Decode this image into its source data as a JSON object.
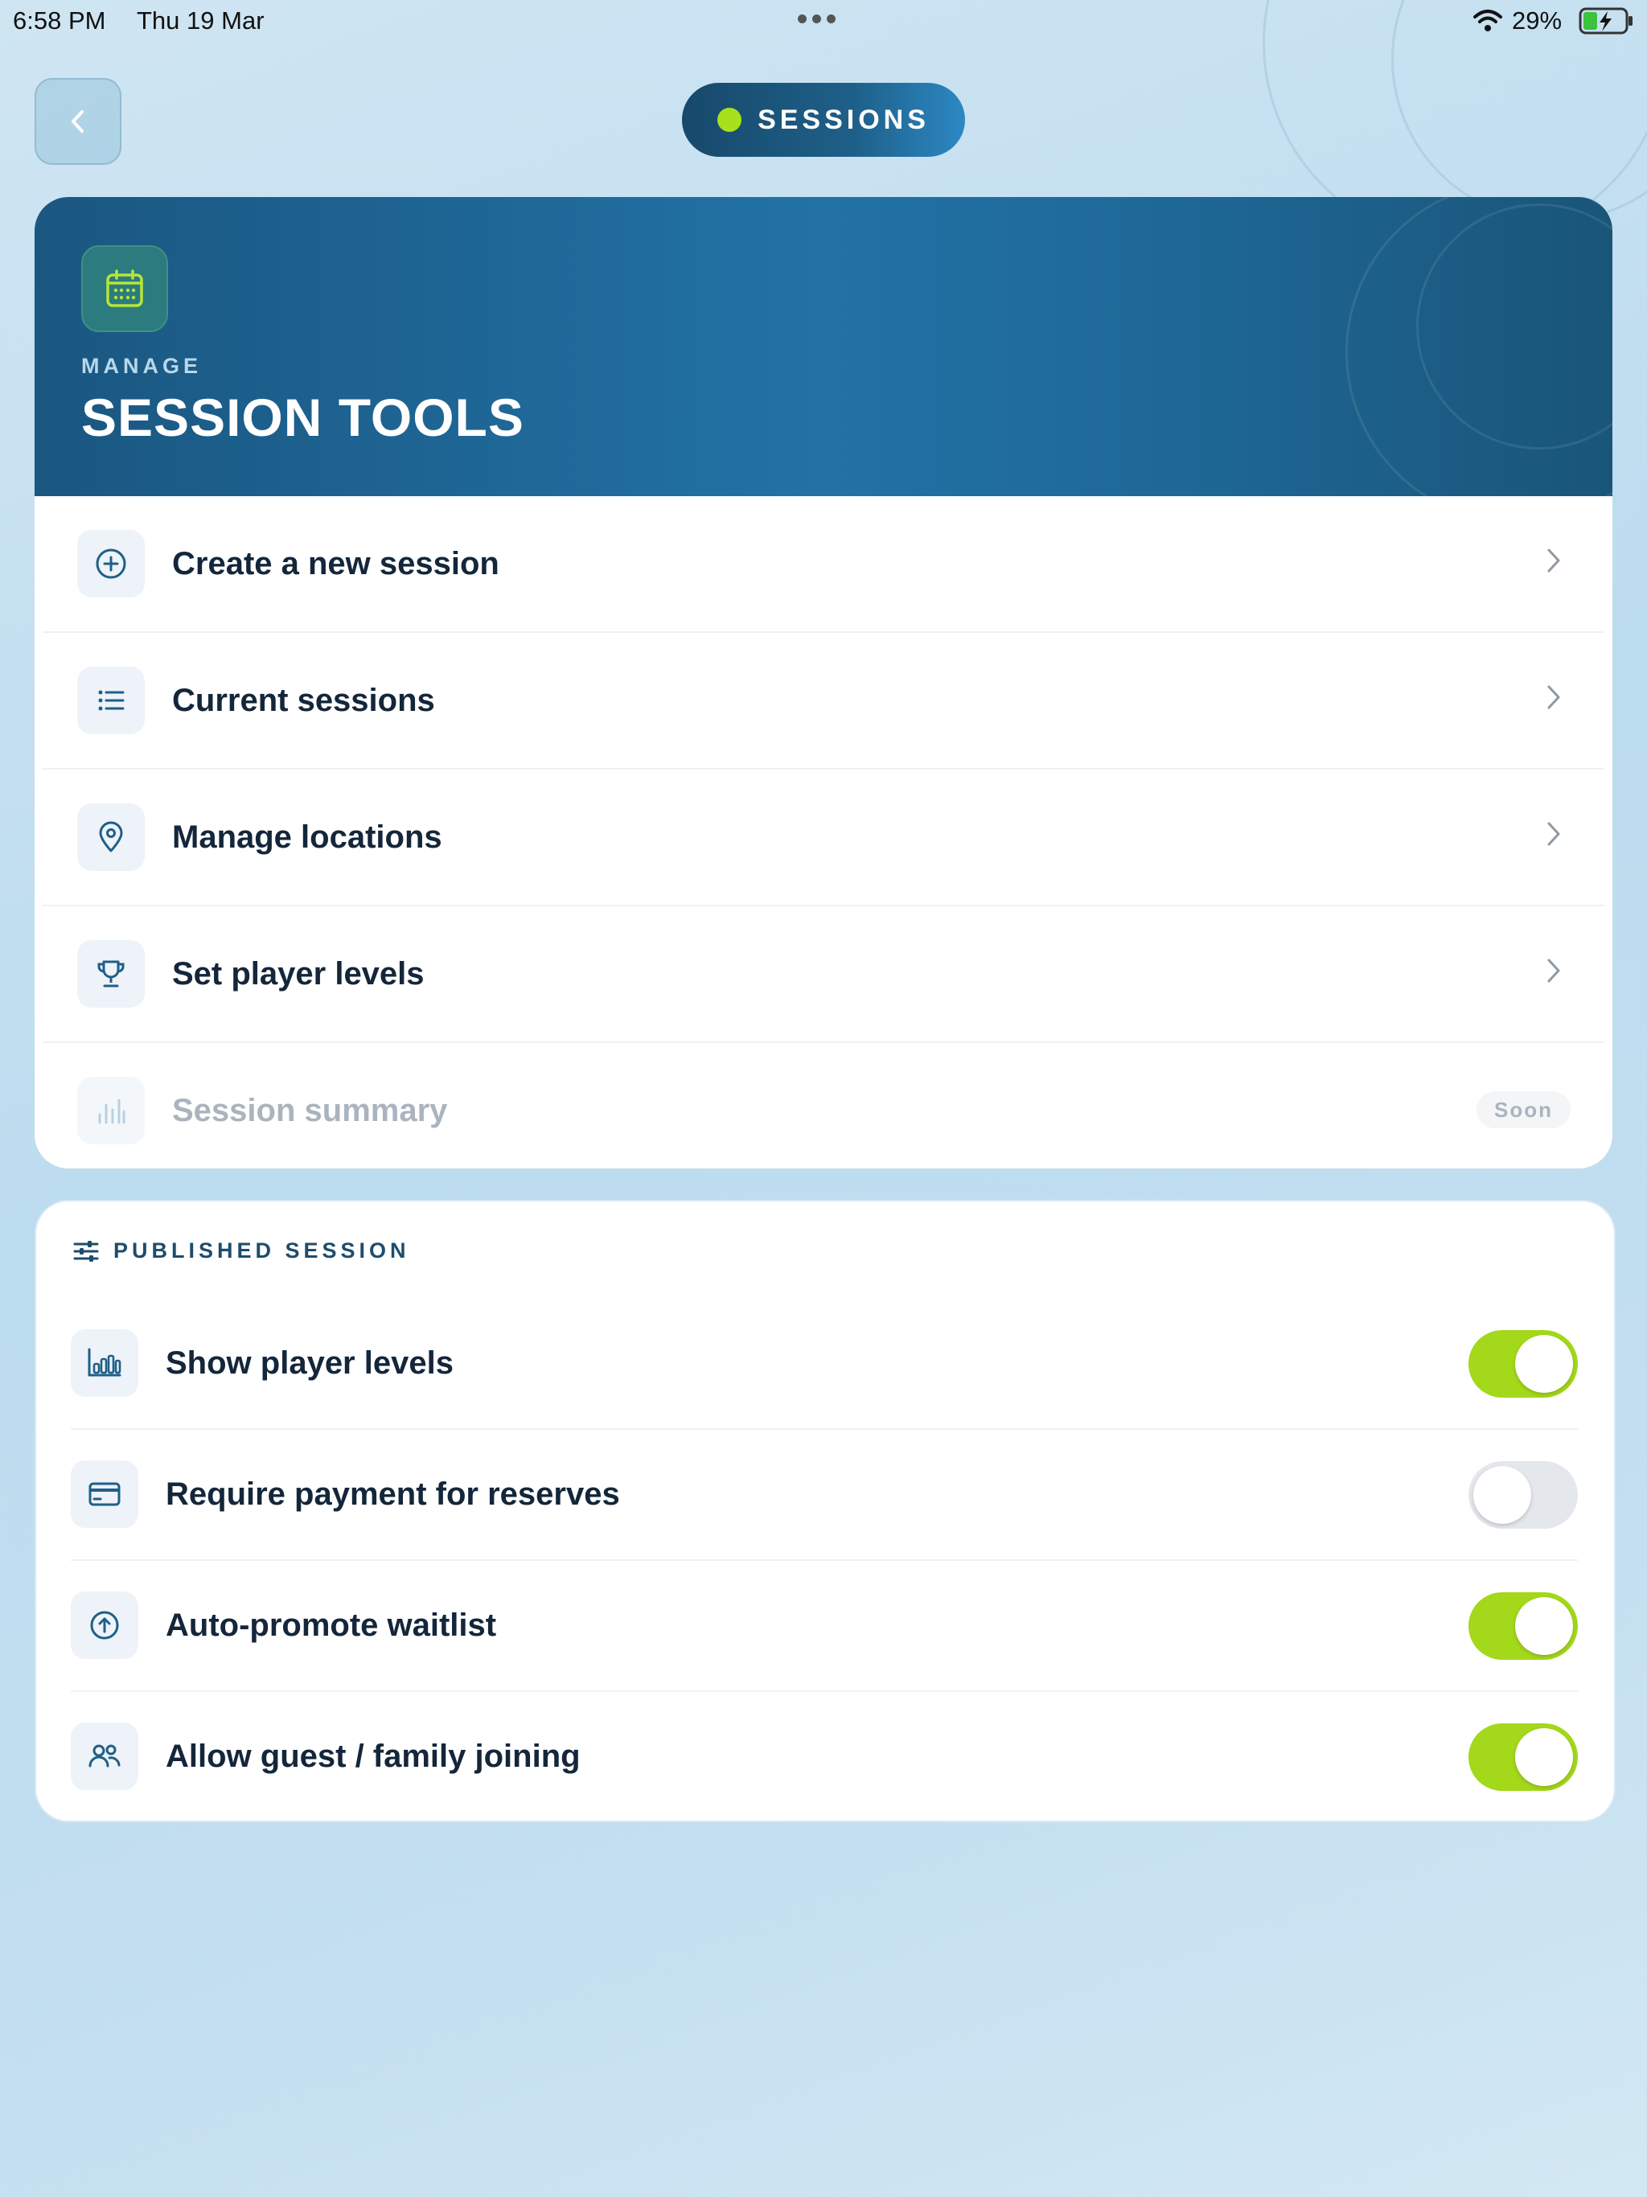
{
  "status_bar": {
    "time": "6:58 PM",
    "date": "Thu 19 Mar",
    "battery_pct": "29%"
  },
  "nav": {
    "back_icon": "chevron-left-icon",
    "pill_label": "SESSIONS",
    "pill_dot_color": "#a8e01d"
  },
  "tools": {
    "kicker": "MANAGE",
    "title": "SESSION TOOLS",
    "icon": "calendar-icon",
    "items": [
      {
        "label": "Create a new session",
        "icon": "plus-circle-icon",
        "enabled": true
      },
      {
        "label": "Current sessions",
        "icon": "list-icon",
        "enabled": true
      },
      {
        "label": "Manage locations",
        "icon": "map-pin-icon",
        "enabled": true
      },
      {
        "label": "Set player levels",
        "icon": "trophy-icon",
        "enabled": true
      },
      {
        "label": "Session summary",
        "icon": "bar-chart-icon",
        "enabled": false,
        "badge": "Soon"
      }
    ]
  },
  "published": {
    "section_title": "PUBLISHED SESSION",
    "section_icon": "sliders-icon",
    "settings": [
      {
        "label": "Show player levels",
        "icon": "bar-chart-icon",
        "enabled": true
      },
      {
        "label": "Require payment for reserves",
        "icon": "credit-card-icon",
        "enabled": false
      },
      {
        "label": "Auto-promote waitlist",
        "icon": "arrow-up-circle-icon",
        "enabled": true
      },
      {
        "label": "Allow guest / family joining",
        "icon": "users-icon",
        "enabled": true
      }
    ]
  },
  "colors": {
    "accent_green": "#a3d81b",
    "hero_blue": "#2272a6",
    "text_dark": "#14263a"
  }
}
